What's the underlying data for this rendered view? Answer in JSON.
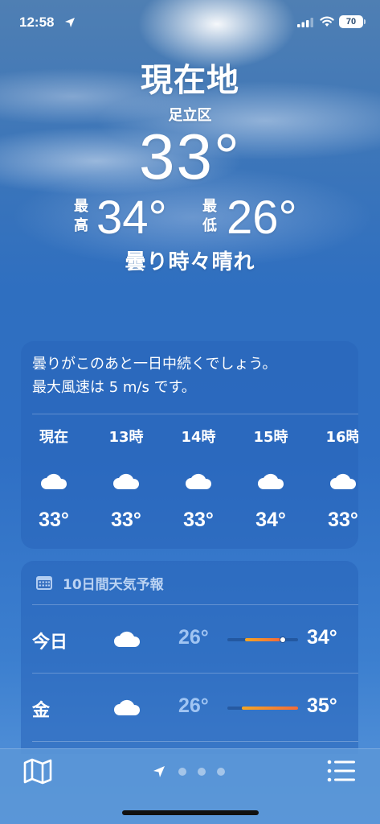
{
  "status_bar": {
    "time": "12:58",
    "battery": "70"
  },
  "header": {
    "title": "現在地",
    "subtitle": "足立区",
    "current_temp": "33°",
    "high_label": "最高",
    "high_value": "34°",
    "low_label": "最低",
    "low_value": "26°",
    "condition": "曇り時々晴れ"
  },
  "hourly": {
    "summary_line1": "曇りがこのあと一日中続くでしょう。",
    "summary_line2": "最大風速は 5 m/s です。",
    "hours": [
      {
        "label": "現在",
        "icon": "cloud-icon",
        "temp": "33°"
      },
      {
        "label": "13時",
        "icon": "cloud-icon",
        "temp": "33°"
      },
      {
        "label": "14時",
        "icon": "cloud-icon",
        "temp": "33°"
      },
      {
        "label": "15時",
        "icon": "cloud-icon",
        "temp": "34°"
      },
      {
        "label": "16時",
        "icon": "cloud-icon",
        "temp": "33°"
      }
    ]
  },
  "daily": {
    "title": "10日間天気予報",
    "days": [
      {
        "name": "今日",
        "icon": "cloud-icon",
        "low": "26°",
        "high": "34°",
        "range_start": 0.25,
        "range_end": 0.75,
        "current": 0.78
      },
      {
        "name": "金",
        "icon": "cloud-icon",
        "low": "26°",
        "high": "35°",
        "range_start": 0.2,
        "range_end": 1.0
      }
    ]
  },
  "bottom_bar": {
    "page_count": 3
  },
  "colors": {
    "temp_bar_start": "#f5a623",
    "temp_bar_end": "#f26b3a",
    "low_temp": "#b4d4fa"
  }
}
